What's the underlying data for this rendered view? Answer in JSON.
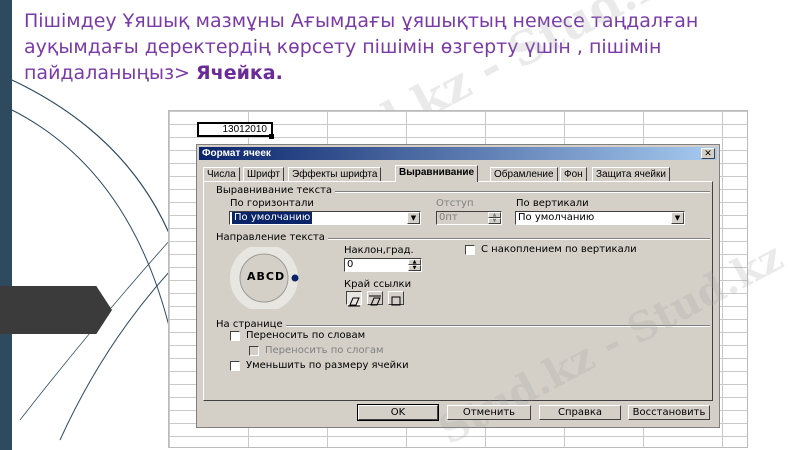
{
  "slide": {
    "title_text": "Пішімдеу Ұяшық мазмұны Ағымдағы ұяшықтың немесе таңдалған ауқымдағы деректердің көрсету пішімін өзгерту үшін , пішімін пайдаланыңыз> ",
    "title_bold": "Ячейка.",
    "watermark": "Stud.kz - Stud.kz"
  },
  "sheet": {
    "cell_value": "13012010"
  },
  "dialog": {
    "title": "Формат ячеек",
    "close_glyph": "✕",
    "tabs": [
      {
        "label": "Числа"
      },
      {
        "label": "Шрифт"
      },
      {
        "label": "Эффекты шрифта"
      },
      {
        "label": "Выравнивание"
      },
      {
        "label": "Обрамление"
      },
      {
        "label": "Фон"
      },
      {
        "label": "Защита ячейки"
      }
    ],
    "active_tab": "Выравнивание",
    "alignment": {
      "group_label": "Выравнивание текста",
      "horizontal_label": "По горизонтали",
      "horizontal_value": "По умолчанию",
      "indent_label": "Отступ",
      "indent_value": "0пт",
      "vertical_label": "По вертикали",
      "vertical_value": "По умолчанию"
    },
    "orientation": {
      "group_label": "Направление текста",
      "dial_text": "ABCD",
      "angle_label": "Наклон,град.",
      "angle_value": "0",
      "stacked_label": "С накоплением по вертикали",
      "edge_label": "Край ссылки"
    },
    "page": {
      "group_label": "На странице",
      "wrap_label": "Переносить по словам",
      "hyphen_label": "Переносить по слогам",
      "shrink_label": "Уменьшить по размеру ячейки"
    },
    "buttons": {
      "ok": "OK",
      "cancel": "Отменить",
      "help": "Справка",
      "reset": "Восстановить"
    }
  },
  "icons": {
    "dropdown": "chevron-down-icon",
    "spin_up": "▲",
    "spin_down": "▼"
  },
  "colors": {
    "title_purple": "#7a3aa8",
    "dialog_bg": "#d4d0c8",
    "titlebar": "#0a246a"
  }
}
